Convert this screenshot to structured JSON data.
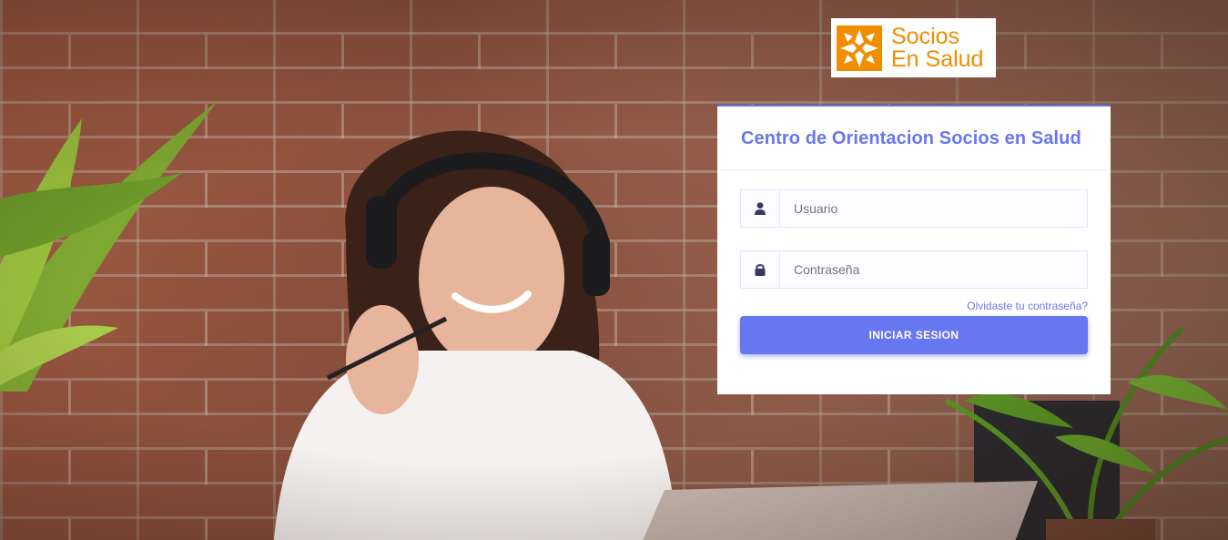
{
  "logo": {
    "line1": "Socios",
    "line2": "En Salud",
    "brand_color": "#f28c00",
    "icon": "hands-logo-icon"
  },
  "login": {
    "title": "Centro de Orientacion Socios en Salud",
    "username": {
      "placeholder": "Usuario",
      "value": "",
      "icon": "user-icon"
    },
    "password": {
      "placeholder": "Contraseña",
      "value": "",
      "icon": "lock-icon"
    },
    "forgot_link": "Olvidaste tu contraseña?",
    "submit_label": "INICIAR SESION",
    "accent_color": "#6777ef"
  }
}
